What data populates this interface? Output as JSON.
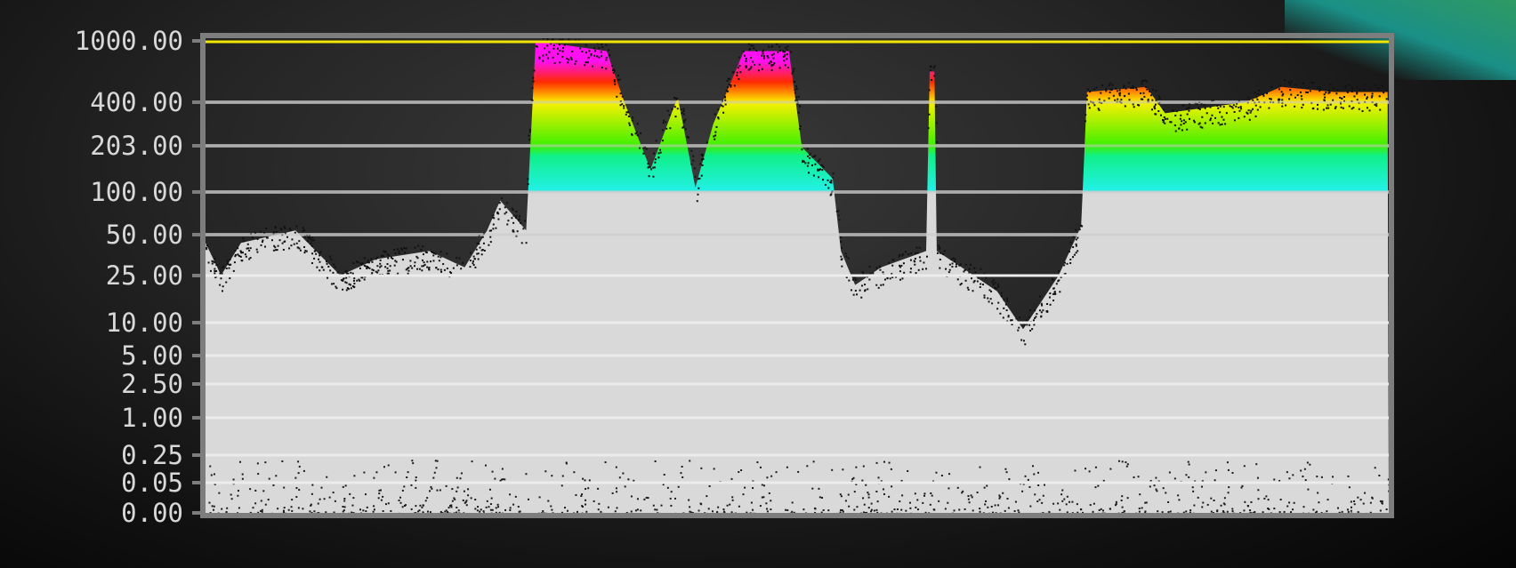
{
  "chart_data": {
    "type": "area",
    "title": "",
    "xlabel": "",
    "ylabel": "",
    "y_scale": "nits (PQ)",
    "ylim": [
      0,
      1000
    ],
    "y_ticks": [
      {
        "value": 1000,
        "label": "1000.00"
      },
      {
        "value": 400,
        "label": "400.00"
      },
      {
        "value": 203,
        "label": "203.00"
      },
      {
        "value": 100,
        "label": "100.00"
      },
      {
        "value": 50,
        "label": "50.00"
      },
      {
        "value": 25,
        "label": "25.00"
      },
      {
        "value": 10,
        "label": "10.00"
      },
      {
        "value": 5,
        "label": "5.00"
      },
      {
        "value": 2.5,
        "label": "2.50"
      },
      {
        "value": 1,
        "label": "1.00"
      },
      {
        "value": 0.25,
        "label": "0.25"
      },
      {
        "value": 0.05,
        "label": "0.05"
      },
      {
        "value": 0,
        "label": "0.00"
      }
    ],
    "reference_line": {
      "value": 1000,
      "color": "#f2e600"
    },
    "waveform_peak": [
      [
        0,
        45
      ],
      [
        1,
        30
      ],
      [
        1.3,
        25
      ],
      [
        3,
        45
      ],
      [
        7.6,
        55
      ],
      [
        11.4,
        25
      ],
      [
        14.4,
        35
      ],
      [
        18.9,
        40
      ],
      [
        21.9,
        30
      ],
      [
        23.8,
        55
      ],
      [
        24.9,
        90
      ],
      [
        27.1,
        55
      ],
      [
        27.9,
        1000
      ],
      [
        33.9,
        900
      ],
      [
        35.4,
        400
      ],
      [
        37.6,
        150
      ],
      [
        39.9,
        450
      ],
      [
        41.4,
        110
      ],
      [
        42.9,
        300
      ],
      [
        45.5,
        900
      ],
      [
        49.3,
        900
      ],
      [
        50.4,
        200
      ],
      [
        53,
        130
      ],
      [
        53.7,
        40
      ],
      [
        54.9,
        22
      ],
      [
        57.1,
        30
      ],
      [
        60.9,
        40
      ],
      [
        61.2,
        700
      ],
      [
        61.6,
        700
      ],
      [
        61.8,
        40
      ],
      [
        63.9,
        30
      ],
      [
        66.9,
        20
      ],
      [
        69.1,
        9
      ],
      [
        72.1,
        25
      ],
      [
        74,
        60
      ],
      [
        74.5,
        500
      ],
      [
        79.5,
        550
      ],
      [
        81.1,
        350
      ],
      [
        87.9,
        400
      ],
      [
        90.9,
        550
      ],
      [
        95.4,
        500
      ],
      [
        99.9,
        500
      ]
    ],
    "colors": {
      "below_100": "#d9d9d9",
      "cyan": "#22f0e6",
      "green": "#3ef000",
      "yellow": "#f8f000",
      "orange": "#ff8a00",
      "magenta": "#ff10f0",
      "grid": "#8a8a8a",
      "frame": "#7d7d7d"
    }
  }
}
